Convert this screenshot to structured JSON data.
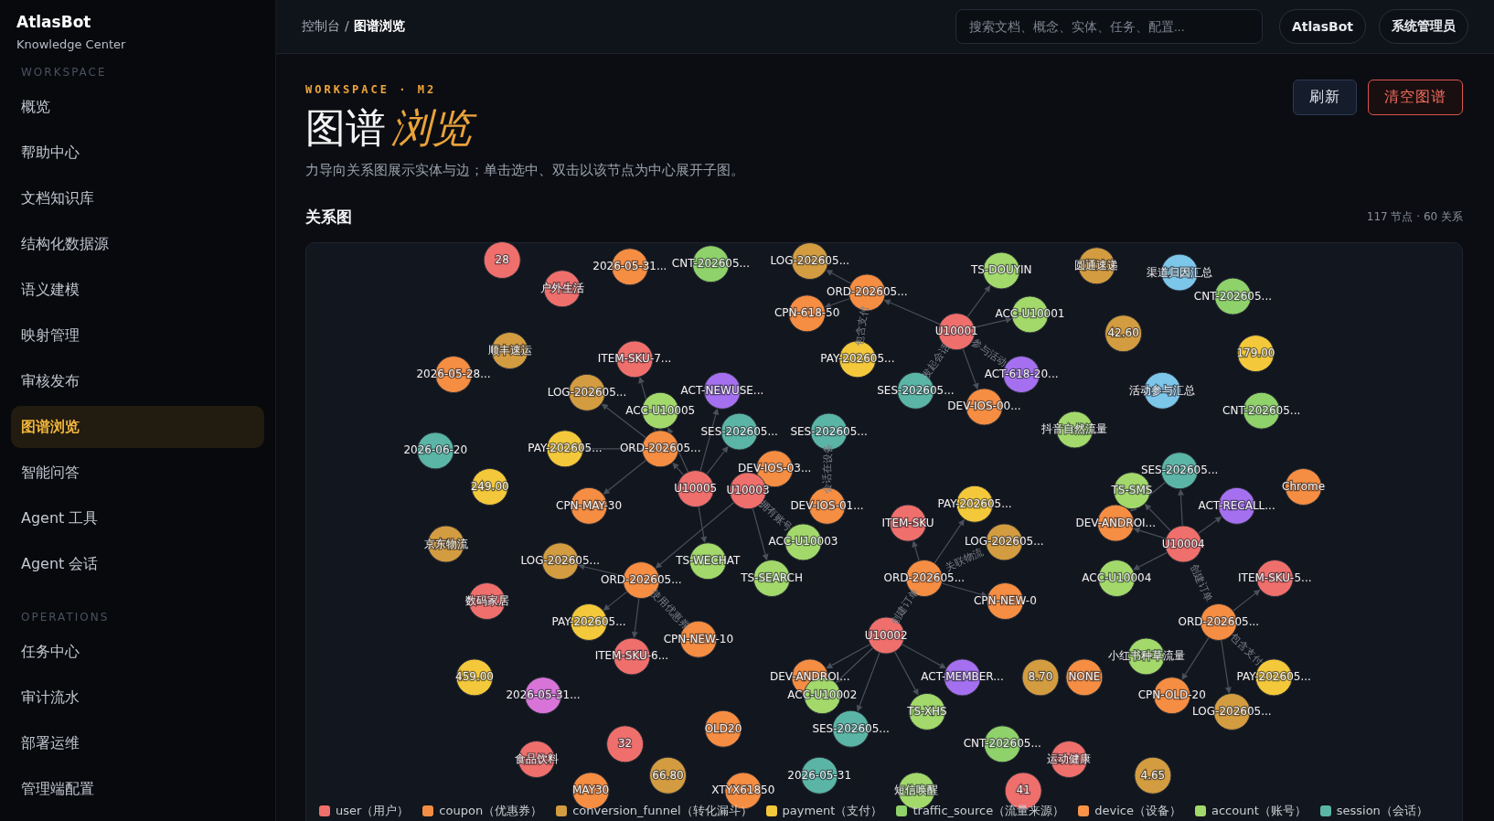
{
  "sidebar": {
    "brand": "AtlasBot",
    "subtitle": "Knowledge Center",
    "sections": [
      {
        "title": "WORKSPACE",
        "items": [
          {
            "label": "概览",
            "selected": false
          },
          {
            "label": "帮助中心",
            "selected": false
          },
          {
            "label": "文档知识库",
            "selected": false
          },
          {
            "label": "结构化数据源",
            "selected": false
          },
          {
            "label": "语义建模",
            "selected": false
          },
          {
            "label": "映射管理",
            "selected": false
          },
          {
            "label": "审核发布",
            "selected": false
          },
          {
            "label": "图谱浏览",
            "selected": true
          },
          {
            "label": "智能问答",
            "selected": false
          },
          {
            "label": "Agent 工具",
            "selected": false
          },
          {
            "label": "Agent 会话",
            "selected": false
          }
        ]
      },
      {
        "title": "OPERATIONS",
        "items": [
          {
            "label": "任务中心",
            "selected": false
          },
          {
            "label": "审计流水",
            "selected": false
          },
          {
            "label": "部署运维",
            "selected": false
          },
          {
            "label": "管理端配置",
            "selected": false
          }
        ]
      }
    ]
  },
  "topbar": {
    "breadcrumb": {
      "items": [
        "控制台",
        "图谱浏览"
      ],
      "separator": "/"
    },
    "search": {
      "placeholder": "搜索文档、概念、实体、任务、配置..."
    },
    "buttons": [
      "AtlasBot",
      "系统管理员"
    ]
  },
  "header": {
    "eyebrow": "WORKSPACE · M2",
    "title": "图谱",
    "title_accent": "浏览",
    "description": "力导向关系图展示实体与边；单击选中、双击以该节点为中心展开子图。",
    "buttons": [
      {
        "label": "刷新",
        "kind": "default"
      },
      {
        "label": "清空图谱",
        "kind": "danger"
      }
    ]
  },
  "graph": {
    "title": "关系图",
    "stats": "117 节点 · 60 关系",
    "nodes": [
      {
        "label": "28",
        "color": "#ef6f6c"
      },
      {
        "label": "2026-05-31...",
        "color": "#f58d42"
      },
      {
        "label": "CNT-202605...",
        "color": "#8fd16a"
      },
      {
        "label": "LOG-202605...",
        "color": "#d39c40"
      },
      {
        "label": "TS-DOUYIN",
        "color": "#a3d96b"
      },
      {
        "label": "圆通速递",
        "color": "#d39c40"
      },
      {
        "label": "渠道归因汇总",
        "color": "#7cc6ea"
      },
      {
        "label": "户外生活",
        "color": "#ef6f6c"
      },
      {
        "label": "ORD-202605...",
        "color": "#f58d42"
      },
      {
        "label": "CNT-202605...",
        "color": "#8fd16a"
      },
      {
        "label": "CPN-618-50",
        "color": "#f58d42"
      },
      {
        "label": "ACC-U10001",
        "color": "#a3d96b"
      },
      {
        "label": "U10001",
        "color": "#ef6f6c"
      },
      {
        "label": "42.60",
        "color": "#d39c40"
      },
      {
        "label": "顺丰速运",
        "color": "#d39c40"
      },
      {
        "label": "ITEM-SKU-7...",
        "color": "#ef6f6c"
      },
      {
        "label": "PAY-202605...",
        "color": "#f3c83a"
      },
      {
        "label": "179.00",
        "color": "#f3c83a"
      },
      {
        "label": "2026-05-28...",
        "color": "#f58d42"
      },
      {
        "label": "ACT-618-20...",
        "color": "#a570f0"
      },
      {
        "label": "LOG-202605...",
        "color": "#d39c40"
      },
      {
        "label": "ACT-NEWUSE...",
        "color": "#a570f0"
      },
      {
        "label": "SES-202605...",
        "color": "#5bb5a6"
      },
      {
        "label": "活动参与汇总",
        "color": "#7cc6ea"
      },
      {
        "label": "ACC-U10005",
        "color": "#a3d96b"
      },
      {
        "label": "DEV-IOS-00...",
        "color": "#f58d42"
      },
      {
        "label": "CNT-202605...",
        "color": "#8fd16a"
      },
      {
        "label": "SES-202605...",
        "color": "#5bb5a6"
      },
      {
        "label": "SES-202605...",
        "color": "#5bb5a6"
      },
      {
        "label": "抖音自然流量",
        "color": "#a3d96b"
      },
      {
        "label": "2026-06-20",
        "color": "#5bb5a6"
      },
      {
        "label": "PAY-202605...",
        "color": "#f3c83a"
      },
      {
        "label": "ORD-202605...",
        "color": "#f58d42"
      },
      {
        "label": "DEV-IOS-03...",
        "color": "#f58d42"
      },
      {
        "label": "SES-202605...",
        "color": "#5bb5a6"
      },
      {
        "label": "249.00",
        "color": "#f3c83a"
      },
      {
        "label": "U10005",
        "color": "#ef6f6c"
      },
      {
        "label": "U10003",
        "color": "#ef6f6c"
      },
      {
        "label": "TS-SMS",
        "color": "#a3d96b"
      },
      {
        "label": "Chrome",
        "color": "#f58d42"
      },
      {
        "label": "CPN-MAY-30",
        "color": "#f58d42"
      },
      {
        "label": "DEV-IOS-01...",
        "color": "#f58d42"
      },
      {
        "label": "PAY-202605...",
        "color": "#f3c83a"
      },
      {
        "label": "ACT-RECALL...",
        "color": "#a570f0"
      },
      {
        "label": "ITEM-SKU",
        "color": "#ef6f6c"
      },
      {
        "label": "DEV-ANDROI...",
        "color": "#f58d42"
      },
      {
        "label": "京东物流",
        "color": "#d39c40"
      },
      {
        "label": "ACC-U10003",
        "color": "#a3d96b"
      },
      {
        "label": "LOG-202605...",
        "color": "#d39c40"
      },
      {
        "label": "U10004",
        "color": "#ef6f6c"
      },
      {
        "label": "LOG-202605...",
        "color": "#d39c40"
      },
      {
        "label": "TS-WECHAT",
        "color": "#a3d96b"
      },
      {
        "label": "ORD-202605...",
        "color": "#f58d42"
      },
      {
        "label": "TS-SEARCH",
        "color": "#a3d96b"
      },
      {
        "label": "ORD-202605...",
        "color": "#f58d42"
      },
      {
        "label": "ACC-U10004",
        "color": "#a3d96b"
      },
      {
        "label": "ITEM-SKU-5...",
        "color": "#ef6f6c"
      },
      {
        "label": "数码家居",
        "color": "#ef6f6c"
      },
      {
        "label": "CPN-NEW-0",
        "color": "#f58d42"
      },
      {
        "label": "PAY-202605...",
        "color": "#f3c83a"
      },
      {
        "label": "ORD-202605...",
        "color": "#f58d42"
      },
      {
        "label": "CPN-NEW-10",
        "color": "#f58d42"
      },
      {
        "label": "U10002",
        "color": "#ef6f6c"
      },
      {
        "label": "ITEM-SKU-6...",
        "color": "#ef6f6c"
      },
      {
        "label": "小红书种草流量",
        "color": "#a3d96b"
      },
      {
        "label": "459.00",
        "color": "#f3c83a"
      },
      {
        "label": "DEV-ANDROI...",
        "color": "#f58d42"
      },
      {
        "label": "ACT-MEMBER...",
        "color": "#a570f0"
      },
      {
        "label": "8.70",
        "color": "#d39c40"
      },
      {
        "label": "NONE",
        "color": "#f58d42"
      },
      {
        "label": "PAY-202605...",
        "color": "#f3c83a"
      },
      {
        "label": "2026-05-31...",
        "color": "#d874d8"
      },
      {
        "label": "ACC-U10002",
        "color": "#a3d96b"
      },
      {
        "label": "CPN-OLD-20",
        "color": "#f58d42"
      },
      {
        "label": "TS-XHS",
        "color": "#a3d96b"
      },
      {
        "label": "LOG-202605...",
        "color": "#d39c40"
      },
      {
        "label": "OLD20",
        "color": "#f58d42"
      },
      {
        "label": "SES-202605...",
        "color": "#5bb5a6"
      },
      {
        "label": "32",
        "color": "#ef6f6c"
      },
      {
        "label": "CNT-202605...",
        "color": "#8fd16a"
      },
      {
        "label": "食品饮料",
        "color": "#ef6f6c"
      },
      {
        "label": "运动健康",
        "color": "#ef6f6c"
      },
      {
        "label": "66.80",
        "color": "#d39c40"
      },
      {
        "label": "2026-05-31",
        "color": "#5bb5a6"
      },
      {
        "label": "4.65",
        "color": "#d39c40"
      },
      {
        "label": "MAY30",
        "color": "#f58d42"
      },
      {
        "label": "XTYX61850",
        "color": "#f58d42"
      },
      {
        "label": "短信唤醒",
        "color": "#a3d96b"
      },
      {
        "label": "41",
        "color": "#ef6f6c"
      }
    ],
    "edge_labels": [
      "包含支付",
      "参与活动",
      "发起会话",
      "会话在设备",
      "拥有账号",
      "关联物流",
      "创建订单",
      "使用优惠券",
      "创建订单",
      "包含支付"
    ],
    "legend": [
      {
        "label": "user（用户）",
        "color": "#ef6f6c"
      },
      {
        "label": "coupon（优惠券）",
        "color": "#f58d42"
      },
      {
        "label": "conversion_funnel（转化漏斗）",
        "color": "#d39c40"
      },
      {
        "label": "payment（支付）",
        "color": "#f3c83a"
      },
      {
        "label": "traffic_source（流量来源）",
        "color": "#8fd16a"
      },
      {
        "label": "device（设备）",
        "color": "#f79448"
      },
      {
        "label": "account（账号）",
        "color": "#a3d96b"
      },
      {
        "label": "session（会话）",
        "color": "#5bb5a6"
      }
    ]
  }
}
